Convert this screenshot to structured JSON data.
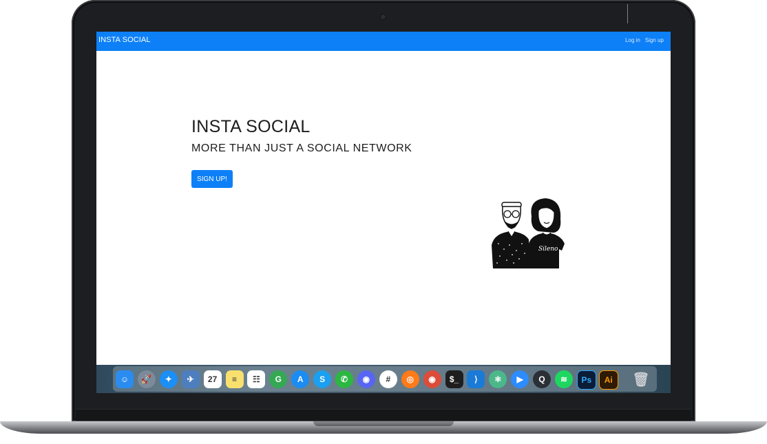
{
  "navbar": {
    "brand": "INSTA SOCIAL",
    "links": [
      "Log in",
      "Sign up"
    ],
    "color": "#0d80f7"
  },
  "hero": {
    "title": "INSTA SOCIAL",
    "subtitle": "MORE THAN JUST A SOCIAL NETWORK",
    "cta_label": "SIGN UP!",
    "illustration_tshirt_text": "Sileno"
  },
  "dock": {
    "apps": [
      {
        "name": "finder-icon",
        "glyph": "☺",
        "color": "#2a8cf0"
      },
      {
        "name": "launchpad-icon",
        "glyph": "🚀",
        "color": "#7d8a99"
      },
      {
        "name": "safari-icon",
        "glyph": "✦",
        "color": "#1b8ff5"
      },
      {
        "name": "preview-icon",
        "glyph": "✈",
        "color": "#4d7fbf"
      },
      {
        "name": "calendar-icon",
        "glyph": "27",
        "color": "#ffffff"
      },
      {
        "name": "notes-icon",
        "glyph": "≡",
        "color": "#f7e06e"
      },
      {
        "name": "reminders-icon",
        "glyph": "☷",
        "color": "#ffffff"
      },
      {
        "name": "maps-icon",
        "glyph": "G",
        "color": "#34a853"
      },
      {
        "name": "app-store-icon",
        "glyph": "A",
        "color": "#1a8cf3"
      },
      {
        "name": "skype-icon",
        "glyph": "S",
        "color": "#1b9ff0"
      },
      {
        "name": "whatsapp-icon",
        "glyph": "✆",
        "color": "#2bb741"
      },
      {
        "name": "discord-icon",
        "glyph": "◉",
        "color": "#5865f2"
      },
      {
        "name": "slack-icon",
        "glyph": "#",
        "color": "#ffffff"
      },
      {
        "name": "firefox-icon",
        "glyph": "◎",
        "color": "#ff7a18"
      },
      {
        "name": "chrome-icon",
        "glyph": "◉",
        "color": "#dd4b39"
      },
      {
        "name": "terminal-icon",
        "glyph": "$_",
        "color": "#1e1e1e"
      },
      {
        "name": "vscode-icon",
        "glyph": "⟩",
        "color": "#1a7ad6"
      },
      {
        "name": "atom-icon",
        "glyph": "⚛",
        "color": "#4cb88a"
      },
      {
        "name": "zoom-icon",
        "glyph": "▶",
        "color": "#2d8cff"
      },
      {
        "name": "quicktime-icon",
        "glyph": "Q",
        "color": "#2b2f36"
      },
      {
        "name": "spotify-icon",
        "glyph": "≋",
        "color": "#1ed760"
      },
      {
        "name": "photoshop-icon",
        "glyph": "Ps",
        "color": "#0b1d36"
      },
      {
        "name": "illustrator-icon",
        "glyph": "Ai",
        "color": "#2e1a05"
      }
    ],
    "trash": {
      "name": "trash-icon",
      "glyph": "🗑",
      "color": "#c9ccd0"
    }
  }
}
